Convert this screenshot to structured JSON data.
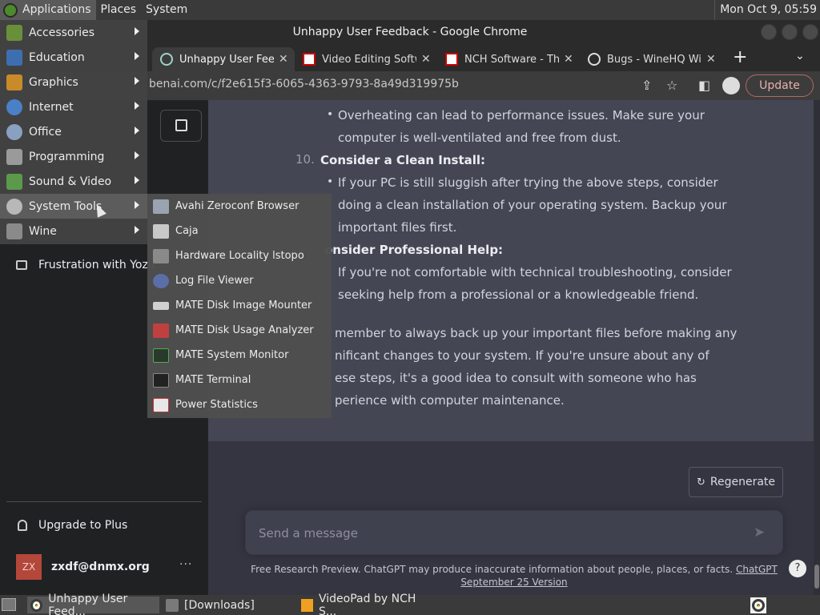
{
  "top_panel": {
    "menus": [
      "Applications",
      "Places",
      "System"
    ],
    "clock": "Mon Oct  9, 05:59"
  },
  "window": {
    "title": "Unhappy User Feedback - Google Chrome"
  },
  "tabs": [
    {
      "label": "Unhappy User Feedback",
      "icon": "chatgpt-icon",
      "active": true
    },
    {
      "label": "Video Editing Software",
      "icon": "nch-icon",
      "active": false
    },
    {
      "label": "NCH Software - Thank you",
      "icon": "nch-icon",
      "active": false
    },
    {
      "label": "Bugs - WineHQ Wiki",
      "icon": "globe-icon",
      "active": false
    }
  ],
  "address_bar": {
    "url": "benai.com/c/f2e615f3-6065-4363-9793-8a49d319975b",
    "update_label": "Update"
  },
  "sidebar": {
    "conversation": "Frustration with Yozu",
    "upgrade_label": "Upgrade to Plus",
    "avatar_initials": "ZX",
    "account_email": "zxdf@dnmx.org",
    "more_label": "···"
  },
  "answer": {
    "lines": [
      "Overheating can lead to performance issues. Make sure your",
      "computer is well-ventilated and free from dust.",
      "Consider a Clean Install:",
      "If your PC is still sluggish after trying the above steps, consider",
      "doing a clean installation of your operating system. Backup your",
      "important files first.",
      "onsider Professional Help:",
      "If you're not comfortable with technical troubleshooting, consider",
      "seeking help from a professional or a knowledgeable friend.",
      "member to always back up your important files before making any",
      "nificant changes to your system. If you're unsure about any of",
      "ese steps, it's a good idea to consult with someone who has",
      "perience with computer maintenance."
    ],
    "number_10": "10."
  },
  "regenerate_label": "Regenerate",
  "composer": {
    "placeholder": "Send a message"
  },
  "footer": {
    "text": "Free Research Preview. ChatGPT may produce inaccurate information about people, places, or facts.",
    "link": "ChatGPT September 25 Version"
  },
  "help_label": "?",
  "app_menu": {
    "items": [
      "Accessories",
      "Education",
      "Graphics",
      "Internet",
      "Office",
      "Programming",
      "Sound & Video",
      "System Tools",
      "Wine"
    ],
    "active": "System Tools"
  },
  "system_tools_submenu": {
    "items": [
      "Avahi Zeroconf Browser",
      "Caja",
      "Hardware Locality lstopo",
      "Log File Viewer",
      "MATE Disk Image Mounter",
      "MATE Disk Usage Analyzer",
      "MATE System Monitor",
      "MATE Terminal",
      "Power Statistics"
    ]
  },
  "taskbar": {
    "tasks": [
      "Unhappy User Feed...",
      "[Downloads]",
      "VideoPad by NCH S..."
    ]
  }
}
